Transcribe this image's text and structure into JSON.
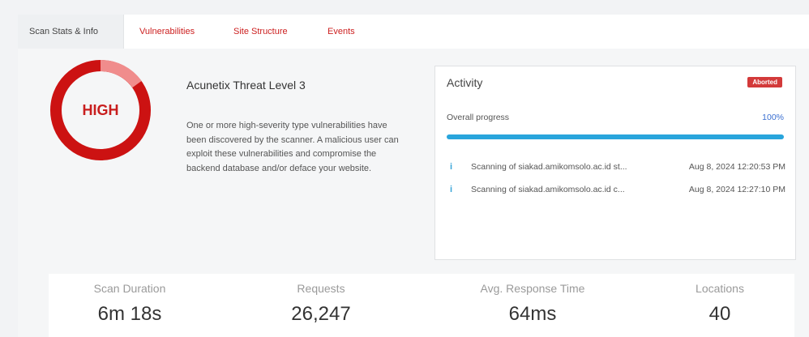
{
  "tabs": [
    {
      "label": "Scan Stats & Info"
    },
    {
      "label": "Vulnerabilities"
    },
    {
      "label": "Site Structure"
    },
    {
      "label": "Events"
    }
  ],
  "threat": {
    "gauge_label": "HIGH",
    "title": "Acunetix Threat Level 3",
    "description": "One or more high-severity type vulnerabilities have been discovered by the scanner. A malicious user can exploit these vulnerabilities and compromise the backend database and/or deface your website.",
    "color_primary": "#cc1212",
    "color_light": "#f08c8c"
  },
  "activity": {
    "title": "Activity",
    "badge": "Aborted",
    "progress_label": "Overall progress",
    "progress_value": "100%",
    "progress_fraction": 1.0,
    "events": [
      {
        "icon": "info-icon",
        "message": "Scanning of siakad.amikomsolo.ac.id st...",
        "time": "Aug 8, 2024 12:20:53 PM"
      },
      {
        "icon": "info-icon",
        "message": "Scanning of siakad.amikomsolo.ac.id c...",
        "time": "Aug 8, 2024 12:27:10 PM"
      }
    ]
  },
  "stats": [
    {
      "label": "Scan Duration",
      "value": "6m 18s"
    },
    {
      "label": "Requests",
      "value": "26,247"
    },
    {
      "label": "Avg. Response Time",
      "value": "64ms"
    },
    {
      "label": "Locations",
      "value": "40"
    }
  ]
}
